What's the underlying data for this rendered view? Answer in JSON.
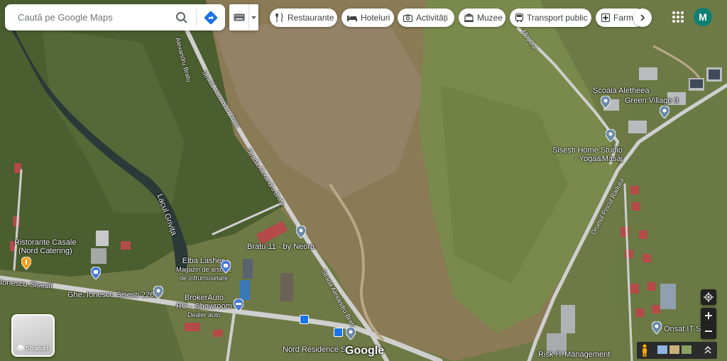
{
  "search": {
    "placeholder": "Caută pe Google Maps"
  },
  "chips": [
    {
      "label": "Restaurante",
      "icon": "fork-knife-icon"
    },
    {
      "label": "Hoteluri",
      "icon": "bed-icon"
    },
    {
      "label": "Activități",
      "icon": "camera-icon"
    },
    {
      "label": "Muzee",
      "icon": "museum-icon"
    },
    {
      "label": "Transport public",
      "icon": "bus-icon"
    },
    {
      "label": "Farma",
      "icon": "pharmacy-icon"
    }
  ],
  "account": {
    "initial": "M",
    "color": "#0f8073"
  },
  "places": {
    "scoala_line1": "Școala Aletheea",
    "green_village": "Green Village 3",
    "home_studio_line1": "Sisești Home Studio",
    "home_studio_line2": "- Yoga&Masaj",
    "bratu": "Bratu 11 - by Neora",
    "elba_line1": "Elba Lashes",
    "elba_line2": "Magazin de articole",
    "elba_line3": "de înfrumusețare",
    "ristorante_line1": "Ristorante Casale",
    "ristorante_line2": "(Nord Catering)",
    "broker_line1": "BrokerAuto",
    "broker_line2": "RO - Showroom",
    "broker_line3": "Dealer auto",
    "nord_residence": "Nord Residence S",
    "risk_it": "Risk IT Management",
    "onsat": "Onsat IT S",
    "lake_line1": "Lacul",
    "lake_line2": "Grivița",
    "ionescu": "Ionescu Sisești",
    "ionescu_226": "Ghe. Ionescu Sisesti 226"
  },
  "roads": {
    "alexandru_bratu": "Strada Alexandru Bratu",
    "bratu_top": "Alexandru Bratu",
    "mosului": "Moșului",
    "drumul_piscul": "Drumul Piscul Radului"
  },
  "layers_label": "Straturi",
  "logo": "Google"
}
